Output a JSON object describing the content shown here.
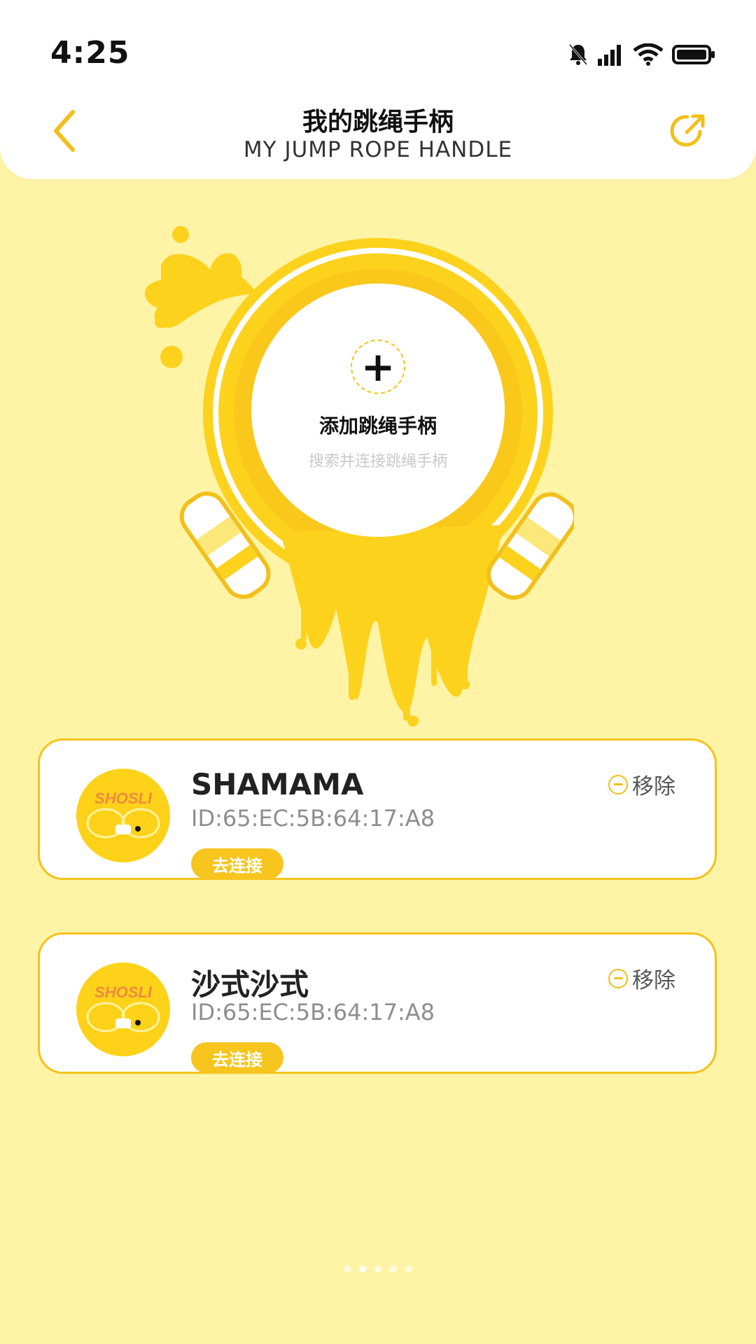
{
  "status_bar": {
    "time": "4:25",
    "icons": [
      "mute-bell-icon",
      "signal-icon",
      "wifi-icon",
      "battery-icon"
    ]
  },
  "header": {
    "title_cn": "我的跳绳手柄",
    "title_en": "MY JUMP ROPE HANDLE",
    "back_icon": "chevron-left-icon",
    "share_icon": "share-icon"
  },
  "add_device": {
    "label": "添加跳绳手柄",
    "sublabel": "搜索并连接跳绳手柄",
    "plus_icon": "+"
  },
  "devices": [
    {
      "name": "SHAMAMA",
      "id": "ID:65:EC:5B:64:17:A8",
      "connect_label": "去连接",
      "remove_label": "移除",
      "logo_text": "SHOSLI"
    },
    {
      "name": "沙式沙式",
      "id": "ID:65:EC:5B:64:17:A8",
      "connect_label": "去连接",
      "remove_label": "移除",
      "logo_text": "SHOSLI"
    }
  ],
  "colors": {
    "accent": "#f7c51d",
    "background": "#fff4a6",
    "card_border": "#f4c21c"
  }
}
